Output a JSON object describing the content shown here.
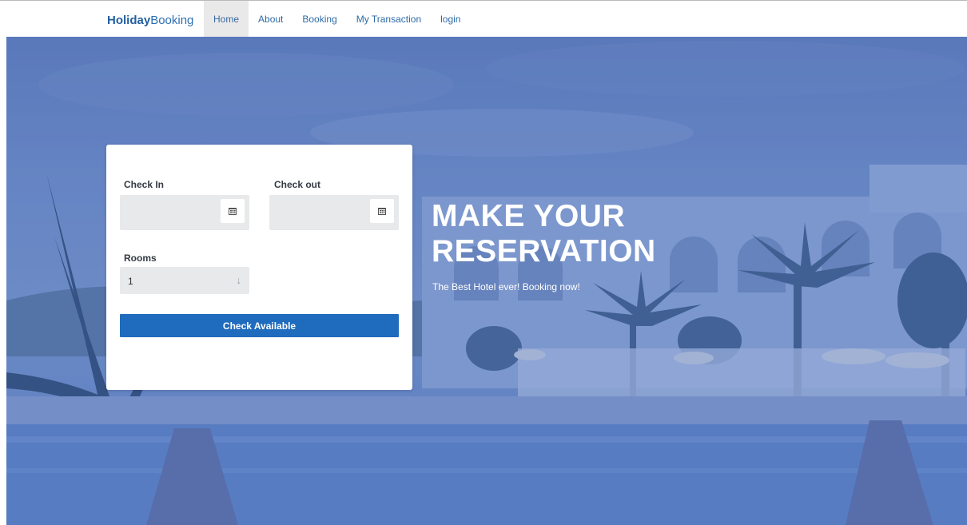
{
  "brand": {
    "bold": "Holiday",
    "rest": "Booking"
  },
  "nav": {
    "items": [
      {
        "label": "Home",
        "active": true
      },
      {
        "label": "About"
      },
      {
        "label": "Booking"
      },
      {
        "label": "My Transaction"
      },
      {
        "label": "login"
      }
    ]
  },
  "form": {
    "check_in_label": "Check In",
    "check_out_label": "Check out",
    "check_in_value": "",
    "check_out_value": "",
    "rooms_label": "Rooms",
    "rooms_value": "1",
    "rooms_icon": "arrow-down-icon",
    "calendar_icon": "calendar-icon",
    "submit_label": "Check Available"
  },
  "hero": {
    "headline_line1": "MAKE YOUR",
    "headline_line2": "RESERVATION",
    "tagline": "The Best Hotel ever! Booking now!"
  },
  "colors": {
    "brand": "#235f9f",
    "nav_link": "#2d6aa6",
    "button": "#1f6bbd",
    "overlay": "#6a89c3"
  }
}
